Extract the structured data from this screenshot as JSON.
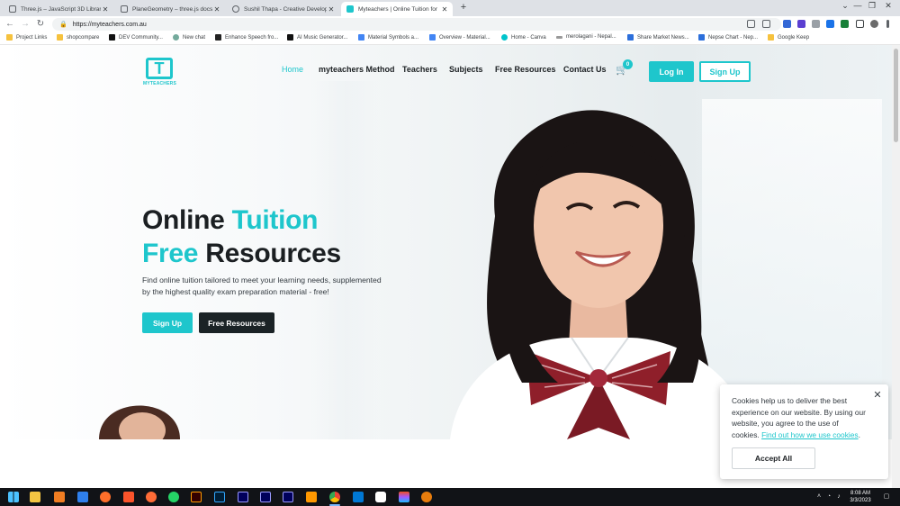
{
  "browser": {
    "tabs": [
      {
        "title": "Three.js – JavaScript 3D Library",
        "close": "✕",
        "active": false,
        "icon_color": "#5f6368"
      },
      {
        "title": "PlaneGeometry – three.js docs",
        "close": "✕",
        "active": false,
        "icon_color": "#5f6368"
      },
      {
        "title": "Sushil Thapa - Creative Develope",
        "close": "✕",
        "active": false,
        "icon_color": "#5f6368"
      },
      {
        "title": "Myteachers | Online Tuition for",
        "close": "✕",
        "active": true,
        "icon_color": "#1ec6cc"
      }
    ],
    "new_tab": "+",
    "window_controls": {
      "minimize": "—",
      "maximize": "❐",
      "close": "✕"
    },
    "nav": {
      "back": "←",
      "forward": "→",
      "reload": "↻"
    },
    "url": "https://myteachers.com.au",
    "bookmarks": [
      {
        "label": "Project Links",
        "color": "#f6c23e"
      },
      {
        "label": "shopcompare",
        "color": "#f6c23e"
      },
      {
        "label": "DEV Community...",
        "color": "#111111"
      },
      {
        "label": "New chat",
        "color": "#74aa9c"
      },
      {
        "label": "Enhance Speech fro...",
        "color": "#222222"
      },
      {
        "label": "AI Music Generator...",
        "color": "#111111"
      },
      {
        "label": "Material Symbols a...",
        "color": "#4285f4"
      },
      {
        "label": "Overview - Material...",
        "color": "#4285f4"
      },
      {
        "label": "Home - Canva",
        "color": "#00c4cc"
      },
      {
        "label": "merolagani - Nepal...",
        "color": "#999999"
      },
      {
        "label": "Share Market News...",
        "color": "#2c6fdb"
      },
      {
        "label": "Nepse Chart - Nep...",
        "color": "#2c6fdb"
      },
      {
        "label": "Google Keep",
        "color": "#f6c23e"
      }
    ]
  },
  "site": {
    "logo_text": "MYTEACHERS",
    "logo_mark": "T",
    "nav": {
      "home": "Home",
      "method": "myteachers Method",
      "teachers": "Teachers",
      "subjects": "Subjects",
      "resources": "Free Resources",
      "contact": "Contact Us"
    },
    "cart_count": "0",
    "login": "Log In",
    "signup": "Sign Up",
    "accent": "#1ec6cc",
    "hero": {
      "line1_a": "Online ",
      "line1_b": "Tuition",
      "line2_a": "Free",
      "line2_b": " Resources",
      "subtitle": "Find online tuition tailored to meet your learning needs, supplemented by the highest quality exam preparation material - free!",
      "cta_primary": "Sign Up",
      "cta_secondary": "Free Resources"
    },
    "cookie": {
      "text": "Cookies help us to deliver the best experience on our website. By using our website, you agree to the use of cookies.",
      "link": "Find out how we use cookies",
      "link_suffix": ".",
      "accept": "Accept All",
      "close": "✕"
    }
  },
  "taskbar": {
    "time": "8:08 AM",
    "date": "3/3/2023",
    "icons": [
      "windows-icon",
      "file-explorer-icon",
      "xampp-icon",
      "node-icon",
      "firefox-icon",
      "brave-icon",
      "postman-icon",
      "whatsapp-icon",
      "illustrator-icon",
      "photoshop-icon",
      "after-effects-icon",
      "media-encoder-icon",
      "premiere-icon",
      "sublime-icon",
      "chrome-icon",
      "vscode-icon",
      "slack-icon",
      "figma-icon",
      "blender-icon"
    ]
  }
}
